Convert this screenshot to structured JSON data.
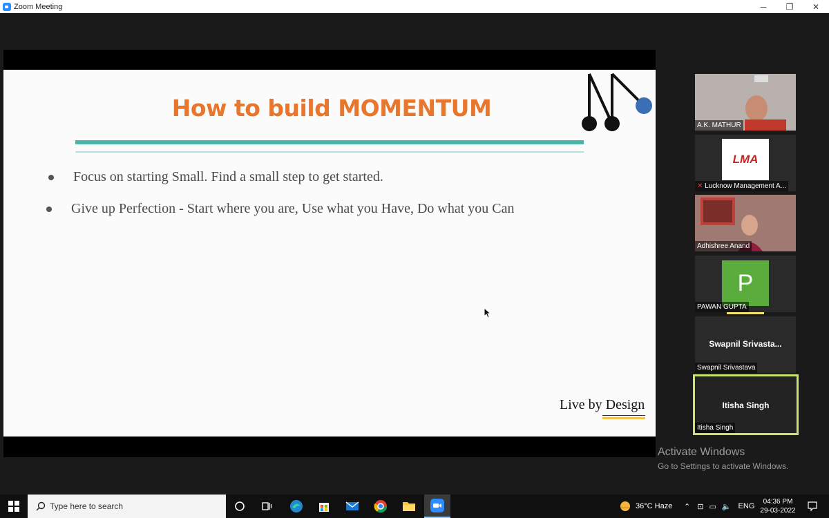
{
  "window": {
    "title": "Zoom Meeting",
    "controls": {
      "minimize": "─",
      "restore": "❐",
      "close": "✕"
    }
  },
  "slide": {
    "title": "How to build MOMENTUM",
    "bullets": [
      "Focus on starting Small. Find a small step to get started.",
      "Give up Perfection - Start where you are, Use what you Have, Do what you Can"
    ],
    "brand": "Live by Design",
    "accent_colors": {
      "title": "#e8762d",
      "rule": "#4db6ac",
      "logo_dot": "#3b6fb5"
    }
  },
  "participants": [
    {
      "name": "A.K. MATHUR"
    },
    {
      "name": "Lucknow Management A...",
      "logo_text": "LMA"
    },
    {
      "name": "Adhishree Anand"
    },
    {
      "name": "PAWAN GUPTA",
      "avatar_letter": "P"
    },
    {
      "name": "Swapnil Srivastava",
      "display_name": "Swapnil  Srivasta..."
    },
    {
      "name": "Itisha Singh",
      "display_name": "Itisha Singh"
    }
  ],
  "watermark": {
    "line1": "Activate Windows",
    "line2": "Go to Settings to activate Windows."
  },
  "taskbar": {
    "search_placeholder": "Type here to search",
    "weather": "36°C  Haze",
    "language": "ENG",
    "time": "04:36 PM",
    "date": "29-03-2022",
    "icons": [
      "windows-start-icon",
      "cortana-icon",
      "task-view-icon",
      "edge-icon",
      "store-icon",
      "mail-icon",
      "chrome-icon",
      "file-explorer-icon",
      "zoom-icon"
    ]
  }
}
